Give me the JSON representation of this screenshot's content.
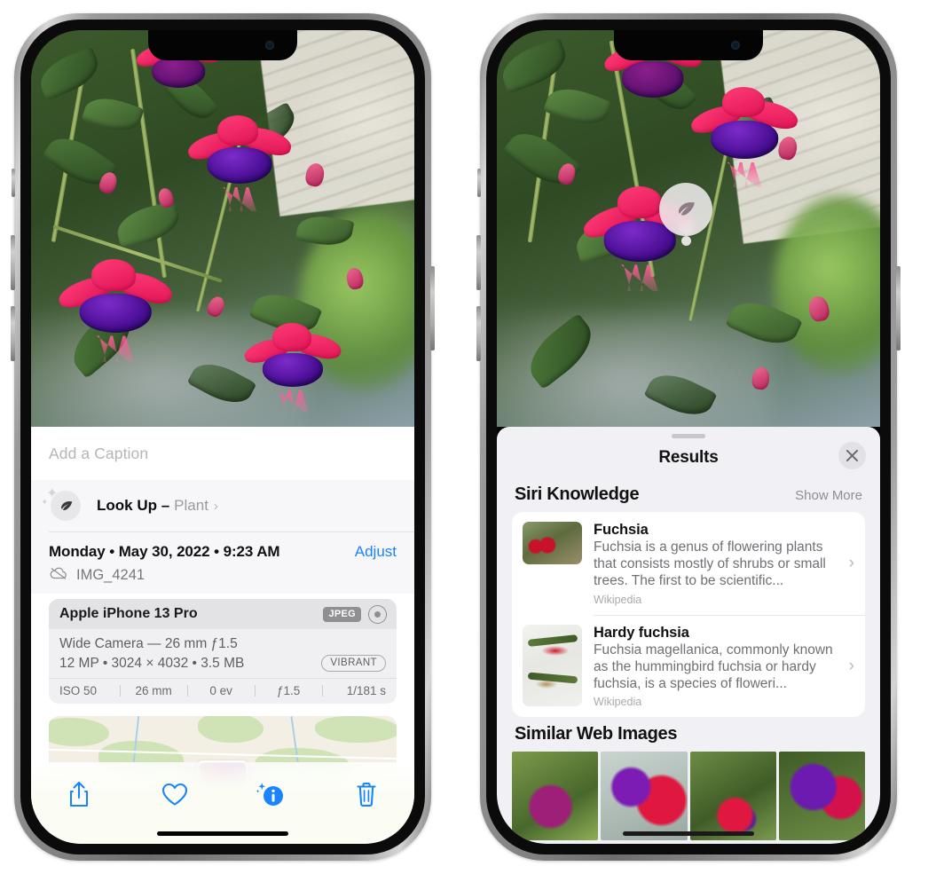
{
  "left_phone": {
    "caption": {
      "placeholder": "Add a Caption",
      "value": ""
    },
    "look_up": {
      "label": "Look Up –",
      "value": "Plant",
      "chevron": "›",
      "icon": "leaf-icon",
      "sparkle": "✦"
    },
    "meta": {
      "date": "Monday • May 30, 2022 • 9:23 AM",
      "adjust": "Adjust",
      "filename": "IMG_4241",
      "cloud_icon": "icloud-slash-icon"
    },
    "camera": {
      "model": "Apple iPhone 13 Pro",
      "format_badge": "JPEG",
      "aperture_icon": "aperture-icon",
      "lens_line": "Wide Camera — 26 mm ƒ1.5",
      "specs_line": "12 MP • 3024 × 4032 • 3.5 MB",
      "style_pill": "VIBRANT",
      "exif": [
        "ISO 50",
        "26 mm",
        "0 ev",
        "ƒ1.5",
        "1/181 s"
      ]
    },
    "toolbar": {
      "items": [
        {
          "name": "share-button",
          "icon": "share-icon"
        },
        {
          "name": "favorite-button",
          "icon": "heart-icon"
        },
        {
          "name": "info-button",
          "icon": "info-sparkle-icon"
        },
        {
          "name": "delete-button",
          "icon": "trash-icon"
        }
      ],
      "accent_color": "#1a84ff"
    }
  },
  "right_phone": {
    "badge": {
      "icon": "leaf-icon",
      "name": "visual-look-up-badge"
    },
    "sheet": {
      "title": "Results",
      "close_icon": "close-icon"
    },
    "siri_knowledge": {
      "title": "Siri Knowledge",
      "show_more": "Show More",
      "results": [
        {
          "title": "Fuchsia",
          "description": "Fuchsia is a genus of flowering plants that consists mostly of shrubs or small trees. The first to be scientific...",
          "source": "Wikipedia",
          "chevron": "›"
        },
        {
          "title": "Hardy fuchsia",
          "description": "Fuchsia magellanica, commonly known as the hummingbird fuchsia or hardy fuchsia, is a species of floweri...",
          "source": "Wikipedia",
          "chevron": "›"
        }
      ]
    },
    "similar_web_images": {
      "title": "Similar Web Images",
      "count": 4
    }
  },
  "colors": {
    "accent_blue": "#1a84ff",
    "sheet_background": "#f1f0f5",
    "card_background": "#ffffff",
    "secondary_text": "#8e8e93"
  }
}
